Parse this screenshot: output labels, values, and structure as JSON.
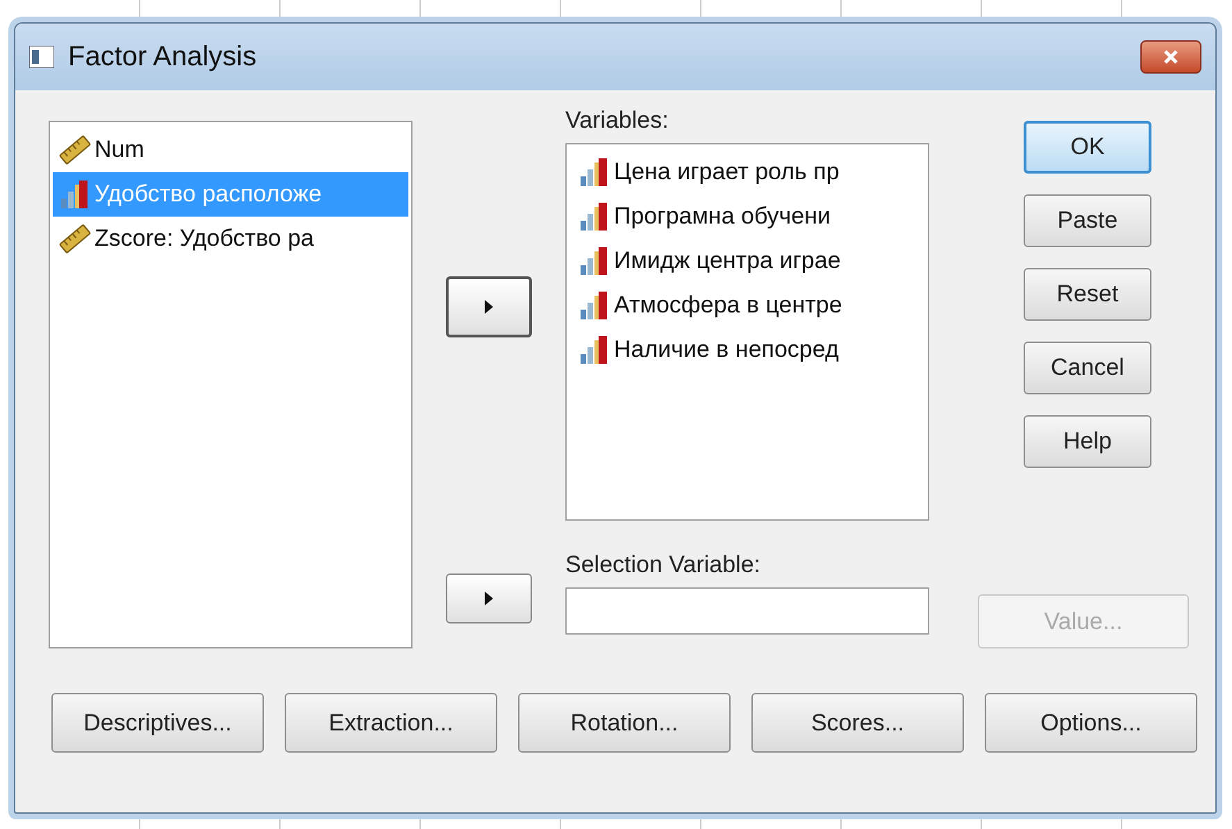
{
  "window": {
    "title": "Factor Analysis"
  },
  "source_list": {
    "items": [
      {
        "label": "Num",
        "kind": "scale",
        "selected": false
      },
      {
        "label": "Удобство расположе",
        "kind": "ordinal",
        "selected": true
      },
      {
        "label": "Zscore:  Удобство ра",
        "kind": "scale",
        "selected": false
      }
    ]
  },
  "variables": {
    "label": "Variables:",
    "items": [
      {
        "label": "Цена играет роль пр",
        "kind": "ordinal"
      },
      {
        "label": "Програмна обучени",
        "kind": "ordinal"
      },
      {
        "label": "Имидж центра играе",
        "kind": "ordinal"
      },
      {
        "label": "Атмосфера в центре",
        "kind": "ordinal"
      },
      {
        "label": "Наличие в непосред",
        "kind": "ordinal"
      }
    ]
  },
  "selection_variable": {
    "label": "Selection Variable:"
  },
  "side_buttons": [
    {
      "label": "OK",
      "default": true
    },
    {
      "label": "Paste",
      "default": false
    },
    {
      "label": "Reset",
      "default": false
    },
    {
      "label": "Cancel",
      "default": false
    },
    {
      "label": "Help",
      "default": false
    }
  ],
  "value_button": {
    "label": "Value...",
    "disabled": true
  },
  "bottom_buttons": [
    "Descriptives...",
    "Extraction...",
    "Rotation...",
    "Scores...",
    "Options..."
  ]
}
